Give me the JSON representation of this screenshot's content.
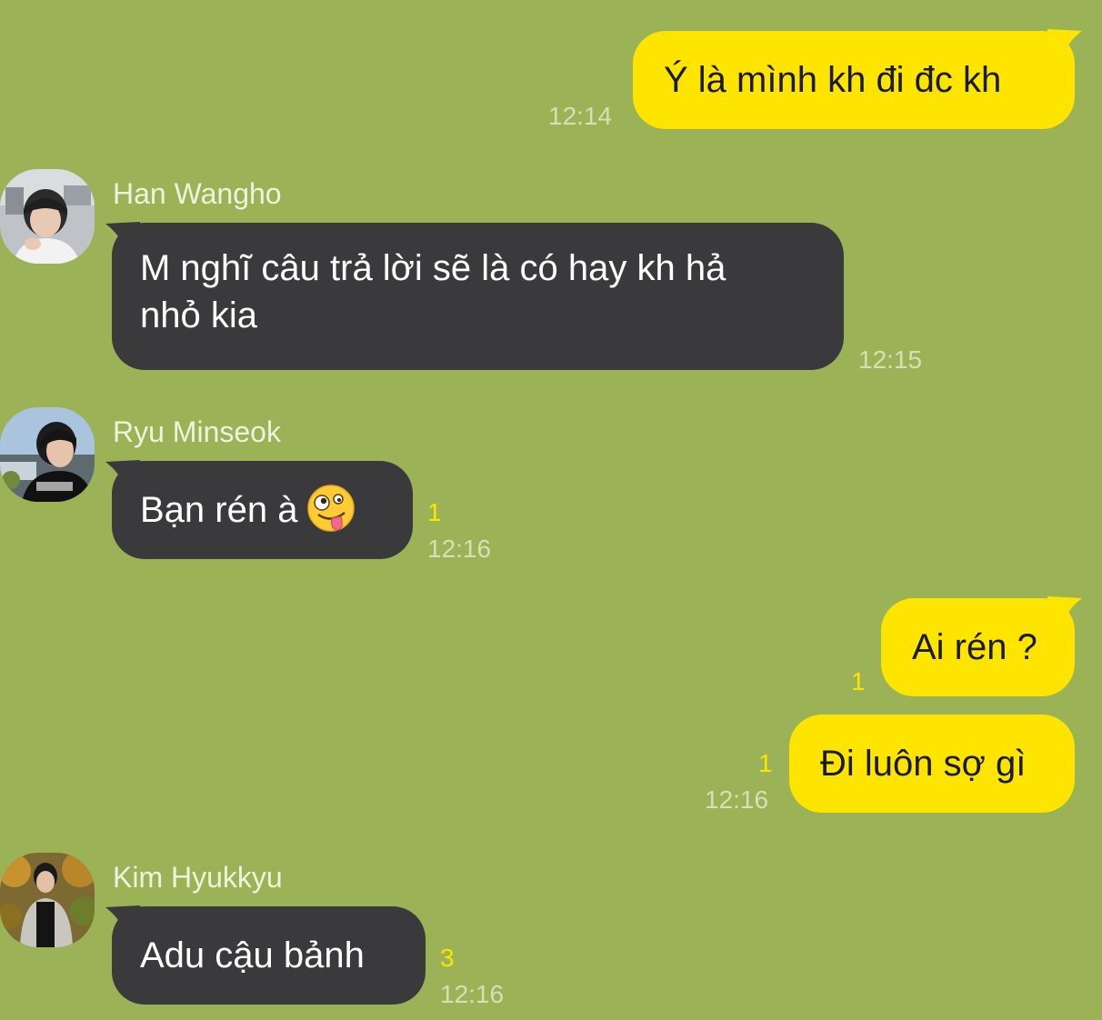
{
  "chat": {
    "messages": [
      {
        "type": "me",
        "text": "Ý là mình kh đi đc kh",
        "time": "12:14"
      },
      {
        "type": "them",
        "sender": "Han Wangho",
        "text_line1": "M nghĩ câu trả lời sẽ là có hay kh hả",
        "text_line2": "nhỏ kia",
        "time": "12:15"
      },
      {
        "type": "them",
        "sender": "Ryu Minseok",
        "text": "Bạn rén à",
        "emoji": "zany-face",
        "unread": "1",
        "time": "12:16"
      },
      {
        "type": "me",
        "text": "Ai rén ?",
        "unread": "1"
      },
      {
        "type": "me",
        "text": "Đi luôn sợ gì",
        "unread": "1",
        "time": "12:16"
      },
      {
        "type": "them",
        "sender": "Kim Hyukkyu",
        "text": "Adu cậu bảnh",
        "unread": "3",
        "time": "12:16"
      }
    ]
  },
  "colors": {
    "background": "#9bb356",
    "my_bubble": "#fee500",
    "their_bubble": "#3a3a3c",
    "unread_count": "#fee500"
  }
}
